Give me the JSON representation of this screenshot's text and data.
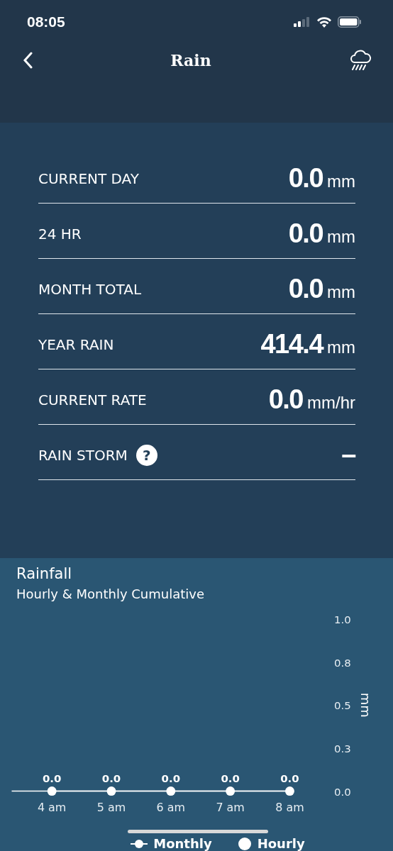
{
  "status_bar": {
    "time": "08:05"
  },
  "nav": {
    "title": "Rain"
  },
  "rows": [
    {
      "label": "CURRENT DAY",
      "value": "0.0",
      "unit": "mm"
    },
    {
      "label": "24 HR",
      "value": "0.0",
      "unit": "mm"
    },
    {
      "label": "MONTH TOTAL",
      "value": "0.0",
      "unit": "mm"
    },
    {
      "label": "YEAR RAIN",
      "value": "414.4",
      "unit": "mm"
    },
    {
      "label": "CURRENT RATE",
      "value": "0.0",
      "unit": "mm/hr"
    },
    {
      "label": "RAIN STORM",
      "help_icon": "?",
      "value": "–"
    }
  ],
  "rainfall": {
    "title": "Rainfall",
    "subtitle": "Hourly & Monthly Cumulative",
    "chart_data": {
      "type": "line",
      "ylabel": "mm",
      "categories": [
        "4 am",
        "5 am",
        "6 am",
        "7 am",
        "8 am"
      ],
      "series": [
        {
          "name": "Monthly",
          "color": "#ffffff",
          "marker": true,
          "values": [
            0.0,
            0.0,
            0.0,
            0.0,
            0.0
          ],
          "value_labels": [
            null,
            null,
            null,
            null,
            null
          ]
        },
        {
          "name": "Hourly",
          "color": "#ffffff",
          "marker": true,
          "values": [
            0.0,
            0.0,
            0.0,
            0.0,
            0.0
          ],
          "value_labels": [
            "0.0",
            "0.0",
            "0.0",
            "0.0",
            "0.0"
          ]
        }
      ],
      "ylim": [
        0,
        1
      ],
      "yticks": [
        {
          "value": 0,
          "label": "0.0"
        },
        {
          "value": 0.25,
          "label": "0.3"
        },
        {
          "value": 0.5,
          "label": "0.5"
        },
        {
          "value": 0.75,
          "label": "0.8"
        },
        {
          "value": 1,
          "label": "1.0"
        }
      ],
      "data_labels": "value_labels"
    }
  }
}
